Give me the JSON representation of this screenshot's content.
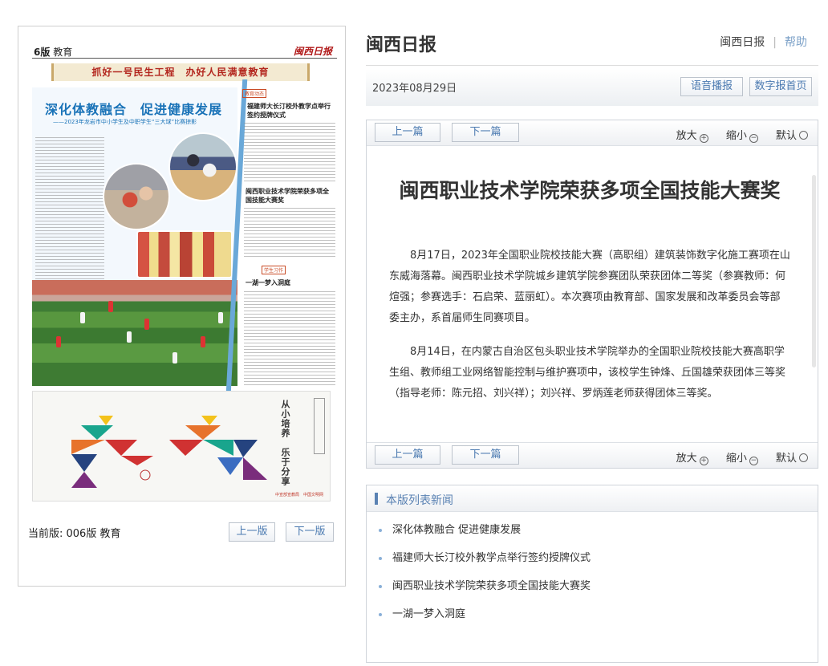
{
  "newspaper": {
    "edition_label": "6版",
    "section": "教育",
    "logo": "闽西日报",
    "banner": "抓好一号民生工程　办好人民满意教育",
    "main_headline": "深化体教融合　促进健康发展",
    "main_subhead": "——2023年龙岩市中小学生及中职学生“三大球”比赛掠影",
    "side_tag1": "教育动态",
    "side_headline1": "福建师大长汀校外教学点举行签约授牌仪式",
    "side_headline2": "闽西职业技术学院荣获多项全国技能大赛奖",
    "side_tag2": "学生习作",
    "side_headline3": "一湖一梦入洞庭",
    "ad_slogan": "从小培养　乐于分享",
    "ad_footer": "中宣部宣教局　中国文明网"
  },
  "left_footer": {
    "current_edition": "当前版: 006版 教育",
    "prev_edition": "上一版",
    "next_edition": "下一版"
  },
  "header": {
    "site_title": "闽西日报",
    "link_paper": "闽西日报",
    "link_help": "帮助"
  },
  "date_bar": {
    "date": "2023年08月29日",
    "voice_button": "语音播报",
    "home_button": "数字报首页"
  },
  "article_nav": {
    "prev": "上一篇",
    "next": "下一篇",
    "zoom_in": "放大",
    "zoom_out": "缩小",
    "default": "默认"
  },
  "article": {
    "title": "闽西职业技术学院荣获多项全国技能大赛奖",
    "paragraphs": [
      "8月17日，2023年全国职业院校技能大赛（高职组）建筑装饰数字化施工赛项在山东威海落幕。闽西职业技术学院城乡建筑学院参赛团队荣获团体二等奖（参赛教师：何煊强；参赛选手：石启荣、蓝丽虹）。本次赛项由教育部、国家发展和改革委员会等部委主办，系首届师生同赛项目。",
      "8月14日，在内蒙古自治区包头职业技术学院举办的全国职业院校技能大赛高职学生组、教师组工业网络智能控制与维护赛项中，该校学生钟烽、丘国雄荣获团体三等奖（指导老师：陈元招、刘兴祥）；刘兴祥、罗炳莲老师获得团体三等奖。"
    ]
  },
  "news_list": {
    "title": "本版列表新闻",
    "items": [
      "深化体教融合 促进健康发展",
      "福建师大长汀校外教学点举行签约授牌仪式",
      "闽西职业技术学院荣获多项全国技能大赛奖",
      "一湖一梦入洞庭"
    ]
  },
  "colors": {
    "accent": "#5a82b3",
    "link_blue": "#4a79b0",
    "headline_blue": "#1a73b8",
    "banner_red": "#b3261e"
  }
}
